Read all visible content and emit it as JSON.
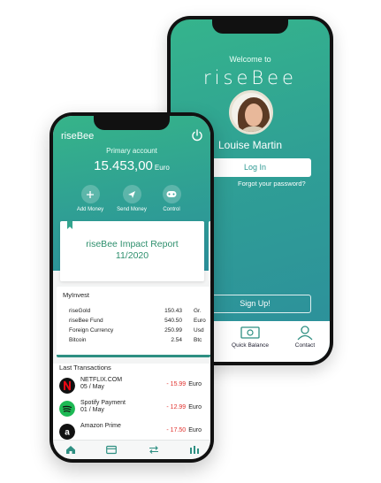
{
  "login_screen": {
    "welcome": "Welcome to",
    "brand": "riseBee",
    "user_name": "Louise Martin",
    "login_label": "Log In",
    "forgot_label": "Forgot your password?",
    "signup_label": "Sign Up!",
    "nav": [
      {
        "label": "Quick Balance",
        "icon": "money-icon"
      },
      {
        "label": "Contact",
        "icon": "contact-icon"
      }
    ]
  },
  "dashboard": {
    "brand": "riseBee",
    "primary_label": "Primary account",
    "balance": {
      "amount": "15.453,00",
      "currency": "Euro"
    },
    "actions": [
      {
        "label": "Add Money",
        "icon": "plus-icon"
      },
      {
        "label": "Send Money",
        "icon": "send-icon"
      },
      {
        "label": "Control",
        "icon": "gamepad-icon"
      }
    ],
    "impact_report": {
      "line1": "riseBee Impact Report",
      "line2": "11/2020"
    },
    "invest": {
      "title": "MyInvest",
      "rows": [
        {
          "name": "riseGold",
          "value": "150.43",
          "unit": "Gr."
        },
        {
          "name": "riseBee Fund",
          "value": "540.50",
          "unit": "Euro"
        },
        {
          "name": "Foreign Currency",
          "value": "250.99",
          "unit": "Usd"
        },
        {
          "name": "Bitcoin",
          "value": "2.54",
          "unit": "Btc"
        }
      ]
    },
    "transactions": {
      "title": "Last Transactions",
      "rows": [
        {
          "line1": "NETFLIX.COM",
          "line2": "05 / May",
          "amount": "- 15.99",
          "currency": "Euro",
          "logo": "netflix-logo"
        },
        {
          "line1": "Spotify Payment",
          "line2": "01 / May",
          "amount": "- 12.99",
          "currency": "Euro",
          "logo": "spotify-logo"
        },
        {
          "line1": "Amazon Prime",
          "line2": "",
          "amount": "- 17.50",
          "currency": "Euro",
          "logo": "amazon-logo"
        }
      ]
    },
    "nav": [
      "home-icon",
      "card-icon",
      "transfer-icon",
      "bars-icon"
    ]
  },
  "colors": {
    "accent": "#33a58e",
    "negative": "#e0312d"
  }
}
